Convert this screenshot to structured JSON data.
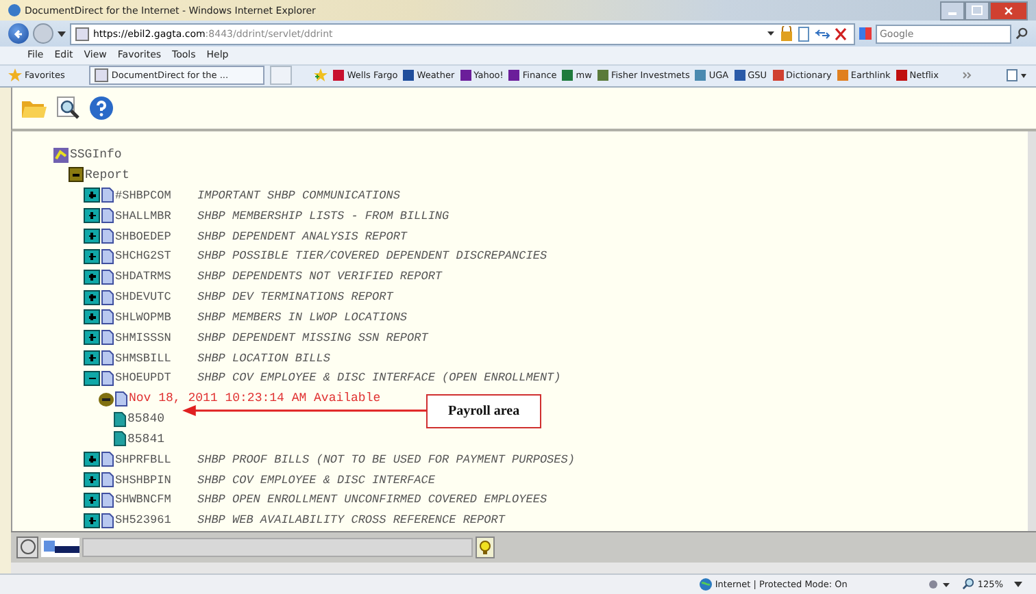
{
  "window": {
    "title": "DocumentDirect for the Internet - Windows Internet Explorer"
  },
  "address": {
    "url_host": "https://ebil2.gagta.com",
    "url_rest": ":8443/ddrint/servlet/ddrint"
  },
  "search": {
    "placeholder": "Google"
  },
  "menu": [
    "File",
    "Edit",
    "View",
    "Favorites",
    "Tools",
    "Help"
  ],
  "favorites_label": "Favorites",
  "tab": {
    "title": "DocumentDirect for the ..."
  },
  "bookmarks": [
    {
      "label": "Wells Fargo",
      "color": "#c8102e"
    },
    {
      "label": "Weather",
      "color": "#1f4e9c"
    },
    {
      "label": "Yahoo!",
      "color": "#6b1e9a"
    },
    {
      "label": "Finance",
      "color": "#6b1e9a"
    },
    {
      "label": "mw",
      "color": "#1e7a3c"
    },
    {
      "label": "Fisher Investmets",
      "color": "#5a7a3a"
    },
    {
      "label": "UGA",
      "color": "#4a8ab0"
    },
    {
      "label": "GSU",
      "color": "#2a5aa8"
    },
    {
      "label": "Dictionary",
      "color": "#d04030"
    },
    {
      "label": "Earthlink",
      "color": "#e08020"
    },
    {
      "label": "Netflix",
      "color": "#c01010"
    }
  ],
  "tree": [
    {
      "kind": "root",
      "label": "SSGInfo",
      "expanded": true,
      "children": [
        {
          "kind": "folder",
          "label": "Report",
          "expanded": true,
          "children": [
            {
              "kind": "report",
              "code": "#SHBPCOM",
              "description": "IMPORTANT SHBP COMMUNICATIONS",
              "expanded": false
            },
            {
              "kind": "report",
              "code": "SHALLMBR",
              "description": "SHBP MEMBERSHIP LISTS - FROM BILLING",
              "expanded": false
            },
            {
              "kind": "report",
              "code": "SHBOEDEP",
              "description": "SHBP DEPENDENT ANALYSIS REPORT",
              "expanded": false
            },
            {
              "kind": "report",
              "code": "SHCHG2ST",
              "description": "SHBP POSSIBLE TIER/COVERED DEPENDENT DISCREPANCIES",
              "expanded": false
            },
            {
              "kind": "report",
              "code": "SHDATRMS",
              "description": "SHBP DEPENDENTS NOT VERIFIED REPORT",
              "expanded": false
            },
            {
              "kind": "report",
              "code": "SHDEVUTC",
              "description": "SHBP DEV TERMINATIONS REPORT",
              "expanded": false
            },
            {
              "kind": "report",
              "code": "SHLWOPMB",
              "description": "SHBP MEMBERS IN LWOP LOCATIONS",
              "expanded": false
            },
            {
              "kind": "report",
              "code": "SHMISSSN",
              "description": "SHBP DEPENDENT MISSING SSN REPORT",
              "expanded": false
            },
            {
              "kind": "report",
              "code": "SHMSBILL",
              "description": "SHBP LOCATION BILLS",
              "expanded": false
            },
            {
              "kind": "report",
              "code": "SHOEUPDT",
              "description": "SHBP COV EMPLOYEE & DISC INTERFACE (OPEN ENROLLMENT)",
              "expanded": true,
              "children": [
                {
                  "kind": "version",
                  "label": "Nov 18, 2011 10:23:14 AM Available",
                  "children": [
                    {
                      "kind": "file",
                      "label": "85840"
                    },
                    {
                      "kind": "file",
                      "label": "85841"
                    }
                  ]
                }
              ]
            },
            {
              "kind": "report",
              "code": "SHPRFBLL",
              "description": "SHBP PROOF BILLS (NOT TO BE USED FOR PAYMENT PURPOSES)",
              "expanded": false
            },
            {
              "kind": "report",
              "code": "SHSHBPIN",
              "description": "SHBP COV EMPLOYEE & DISC INTERFACE",
              "expanded": false
            },
            {
              "kind": "report",
              "code": "SHWBNCFM",
              "description": "SHBP OPEN ENROLLMENT UNCONFIRMED COVERED EMPLOYEES",
              "expanded": false
            },
            {
              "kind": "report",
              "code": "SH523961",
              "description": "SHBP WEB AVAILABILITY CROSS REFERENCE REPORT",
              "expanded": false
            }
          ]
        }
      ]
    }
  ],
  "callout": {
    "label": "Payroll area"
  },
  "status_bar": {
    "zone": "Internet | Protected Mode: On",
    "zoom": "125%"
  }
}
